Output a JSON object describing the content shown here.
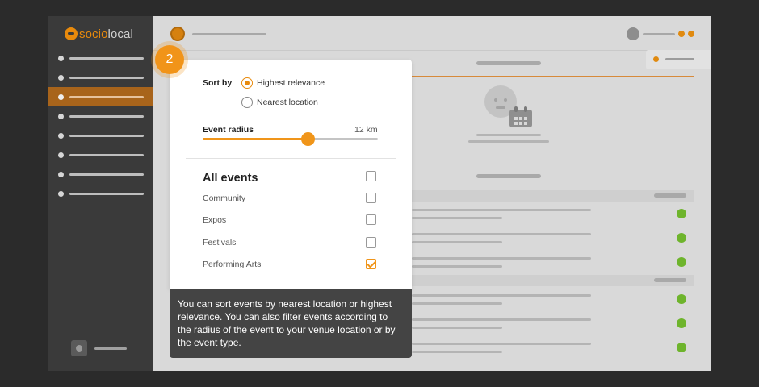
{
  "logo": {
    "part1": "socio",
    "part2": "local"
  },
  "popup": {
    "step_number": "2",
    "sort_label": "Sort by",
    "sort_options": [
      {
        "label": "Highest relevance",
        "selected": true
      },
      {
        "label": "Nearest location",
        "selected": false
      }
    ],
    "radius_label": "Event radius",
    "radius_value": "12 km",
    "radius_fraction": 0.6,
    "all_events_label": "All events",
    "categories": [
      {
        "label": "Community",
        "checked": false
      },
      {
        "label": "Expos",
        "checked": false
      },
      {
        "label": "Festivals",
        "checked": false
      },
      {
        "label": "Performing Arts",
        "checked": true
      }
    ],
    "all_events_checked": false
  },
  "tooltip": {
    "text": "You can sort events by nearest location or highest relevance. You can also filter events according to the radius of the event to your venue location or by the event type."
  },
  "colors": {
    "accent": "#f0951a",
    "sidebar": "#3a3a3a",
    "status_green": "#6eb42c",
    "tooltip_bg": "#444444"
  }
}
